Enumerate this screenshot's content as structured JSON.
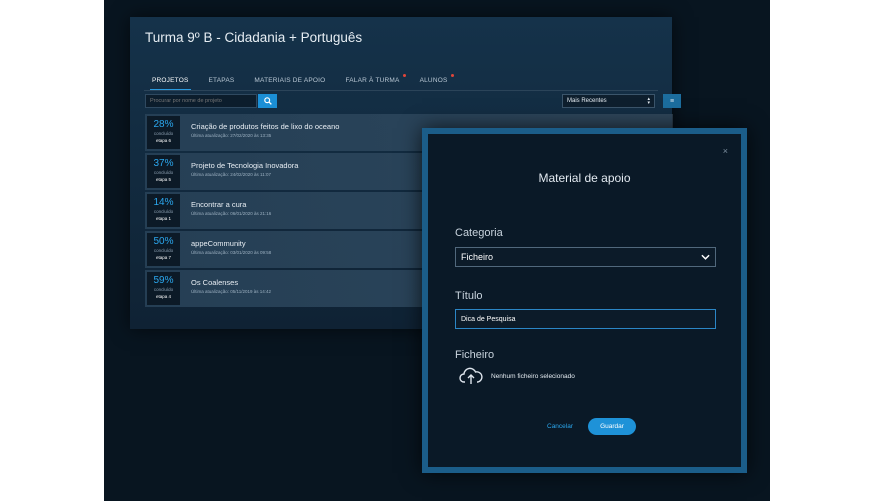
{
  "window": {
    "title": "Turma 9º B - Cidadania + Português"
  },
  "tabs": [
    {
      "label": "PROJETOS",
      "active": true,
      "dot": false
    },
    {
      "label": "ETAPAS",
      "active": false,
      "dot": false
    },
    {
      "label": "MATERIAIS DE APOIO",
      "active": false,
      "dot": false
    },
    {
      "label": "FALAR À TURMA",
      "active": false,
      "dot": true
    },
    {
      "label": "ALUNOS",
      "active": false,
      "dot": true
    }
  ],
  "search": {
    "placeholder": "Procurar por nome de projeto",
    "icon": "search-icon"
  },
  "sort": {
    "selected": "Mais Recentes"
  },
  "projects": [
    {
      "percent": "28%",
      "status": "concluído",
      "stage": "etapa 6",
      "name": "Criação de produtos feitos de lixo do oceano",
      "updated": "Última atualização: 27/02/2020 às 13:35"
    },
    {
      "percent": "37%",
      "status": "concluído",
      "stage": "etapa 5",
      "name": "Projeto de Tecnologia Inovadora",
      "updated": "Última atualização: 24/02/2020 às 11:07"
    },
    {
      "percent": "14%",
      "status": "concluído",
      "stage": "etapa 1",
      "name": "Encontrar a cura",
      "updated": "Última atualização: 06/01/2020 às 21:16"
    },
    {
      "percent": "50%",
      "status": "concluído",
      "stage": "etapa 7",
      "name": "appeCommunity",
      "updated": "Última atualização: 03/01/2020 às 09:58"
    },
    {
      "percent": "59%",
      "status": "concluído",
      "stage": "etapa 4",
      "name": "Os Coalenses",
      "updated": "Última atualização: 05/11/2019 às 14:42"
    }
  ],
  "modal": {
    "title": "Material de apoio",
    "close": "×",
    "category_label": "Categoria",
    "category_value": "Ficheiro",
    "title_label": "Título",
    "title_value": "Dica de Pesquisa",
    "file_label": "Ficheiro",
    "file_status": "Nenhum ficheiro selecionado",
    "cancel": "Cancelar",
    "save": "Guardar"
  },
  "colors": {
    "accent": "#1e92d8",
    "modal_border": "#1b5d89",
    "background": "#081520"
  }
}
